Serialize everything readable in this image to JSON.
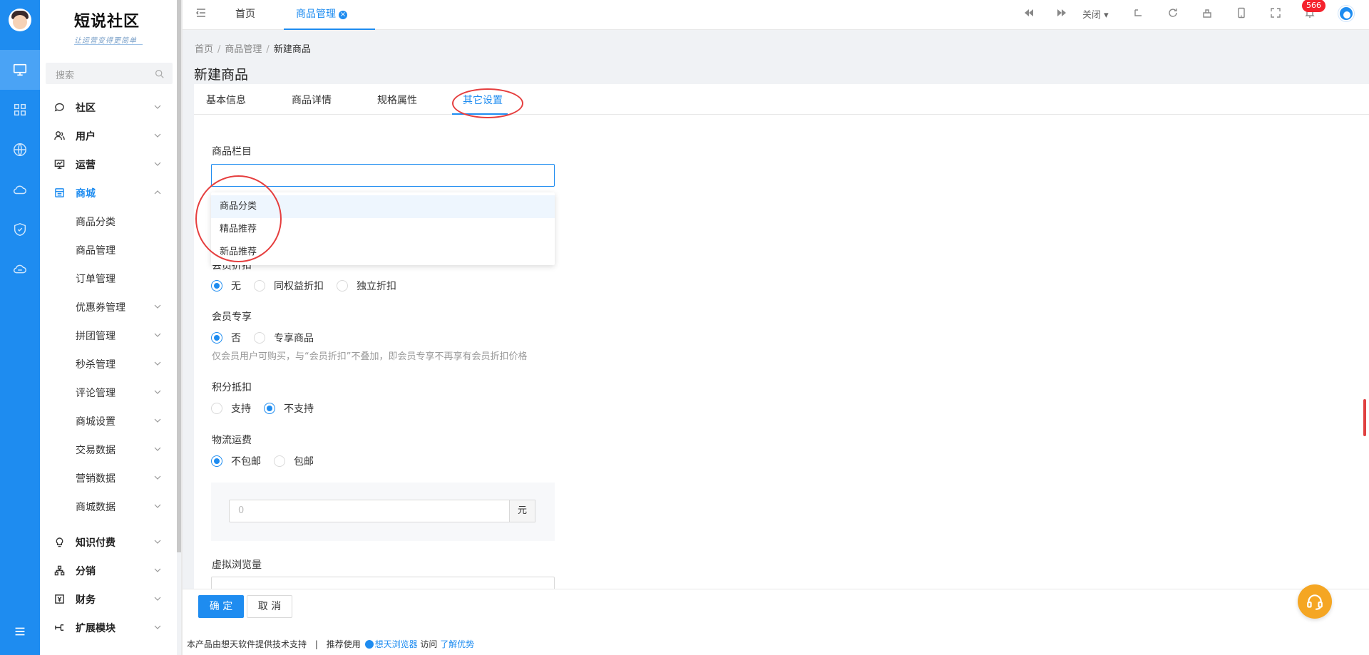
{
  "app": {
    "title": "短说社区",
    "subtitle": "让运营变得更简单"
  },
  "sidebar": {
    "search_placeholder": "搜索",
    "menu": [
      {
        "label": "社区",
        "icon": "chat-icon",
        "open": false
      },
      {
        "label": "用户",
        "icon": "users-icon",
        "open": false
      },
      {
        "label": "运营",
        "icon": "operation-icon",
        "open": false
      },
      {
        "label": "商城",
        "icon": "shop-icon",
        "open": true
      }
    ],
    "shop_sub": [
      {
        "label": "商品分类",
        "has_children": false
      },
      {
        "label": "商品管理",
        "has_children": false
      },
      {
        "label": "订单管理",
        "has_children": false
      },
      {
        "label": "优惠券管理",
        "has_children": true
      },
      {
        "label": "拼团管理",
        "has_children": true
      },
      {
        "label": "秒杀管理",
        "has_children": true
      },
      {
        "label": "评论管理",
        "has_children": true
      },
      {
        "label": "商城设置",
        "has_children": true
      },
      {
        "label": "交易数据",
        "has_children": true
      },
      {
        "label": "营销数据",
        "has_children": true
      },
      {
        "label": "商城数据",
        "has_children": true
      }
    ],
    "menu_bottom": [
      {
        "label": "知识付费",
        "icon": "bulb-icon"
      },
      {
        "label": "分销",
        "icon": "hierarchy-icon"
      },
      {
        "label": "财务",
        "icon": "finance-icon"
      },
      {
        "label": "扩展模块",
        "icon": "extension-icon"
      }
    ]
  },
  "topbar": {
    "tabs": [
      {
        "label": "首页",
        "active": false
      },
      {
        "label": "商品管理",
        "active": true
      }
    ],
    "close_label": "关闭",
    "notification_count": "566"
  },
  "breadcrumb": {
    "home": "首页",
    "parent": "商品管理",
    "current": "新建商品"
  },
  "page": {
    "title": "新建商品"
  },
  "form_tabs": [
    {
      "label": "基本信息",
      "active": false
    },
    {
      "label": "商品详情",
      "active": false
    },
    {
      "label": "规格属性",
      "active": false
    },
    {
      "label": "其它设置",
      "active": true
    }
  ],
  "form": {
    "column": {
      "label": "商品栏目",
      "value": "",
      "options": [
        "商品分类",
        "精品推荐",
        "新品推荐"
      ]
    },
    "member_discount": {
      "label": "会员折扣",
      "options": [
        "无",
        "同权益折扣",
        "独立折扣"
      ],
      "selected": "无"
    },
    "member_exclusive": {
      "label": "会员专享",
      "options": [
        "否",
        "专享商品"
      ],
      "selected": "否",
      "help": "仅会员用户可购买，与“会员折扣”不叠加，即会员专享不再享有会员折扣价格"
    },
    "points": {
      "label": "积分抵扣",
      "options": [
        "支持",
        "不支持"
      ],
      "selected": "不支持"
    },
    "shipping": {
      "label": "物流运费",
      "options": [
        "不包邮",
        "包邮"
      ],
      "selected": "不包邮",
      "fee_placeholder": "0",
      "unit": "元"
    },
    "virtual_views": {
      "label": "虚拟浏览量"
    }
  },
  "actions": {
    "confirm": "确 定",
    "cancel": "取 消"
  },
  "footer": {
    "text1": "本产品由想天软件提供技术支持",
    "sep": "|",
    "text2": "推荐使用",
    "browser": "想天浏览器",
    "text3": "访问",
    "link": "了解优势"
  },
  "colors": {
    "primary": "#1e8cf0",
    "annotation": "#e53e3e",
    "service": "#f5a623"
  }
}
